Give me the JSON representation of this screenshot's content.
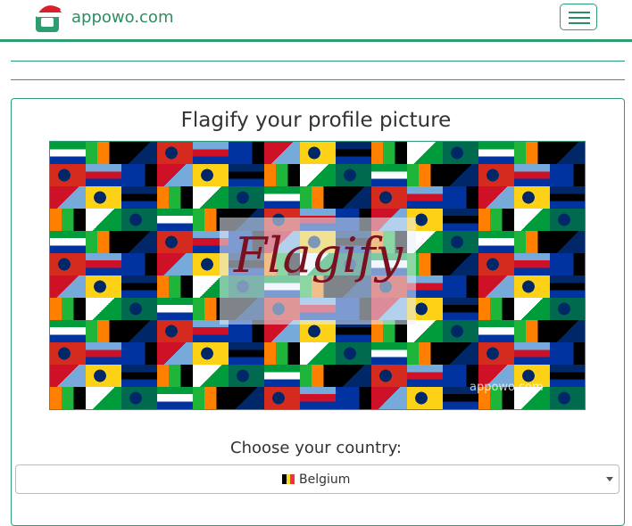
{
  "header": {
    "brand": "appowo.com",
    "logo_icon": "santa-hat-logo-icon",
    "menu_icon": "hamburger-menu-icon"
  },
  "main": {
    "title": "Flagify your profile picture",
    "banner": {
      "title_text": "Flagify",
      "watermark": "appowo.com"
    },
    "choose_label": "Choose your country:",
    "country_select": {
      "value": "Belgium",
      "flag_colors": [
        "#000000",
        "#FDDA24",
        "#EF3340"
      ]
    }
  },
  "colors": {
    "accent": "#2e9e72",
    "flagify_text": "#7a1020"
  }
}
